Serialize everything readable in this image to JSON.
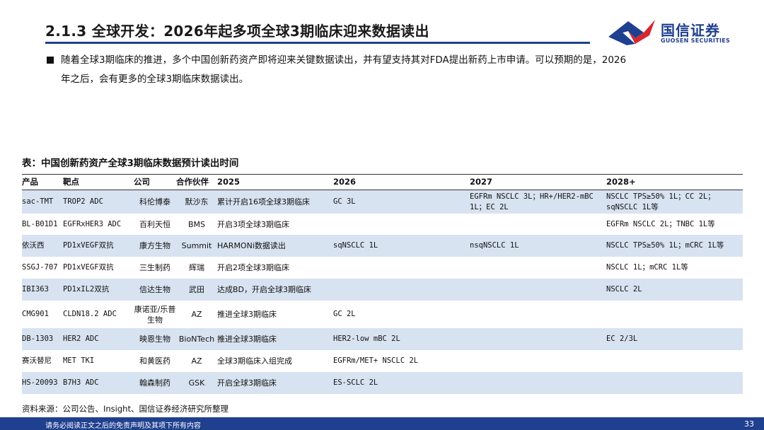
{
  "header": {
    "title": "2.1.3 全球开发：2026年起多项全球3期临床迎来数据读出",
    "logo_cn": "国信证券",
    "logo_en": "GUOSEN SECURITIES"
  },
  "bullet": {
    "line1": "随着全球3期临床的推进，多个中国创新药资产即将迎来关键数据读出，并有望支持其对FDA提出新药上市申请。可以预期的是，2026",
    "line2": "年之后，会有更多的全球3期临床数据读出。"
  },
  "table": {
    "title": "表：中国创新药资产全球3期临床数据预计读出时间",
    "headers": [
      "产品",
      "靶点",
      "公司",
      "合作伙伴",
      "2025",
      "2026",
      "2027",
      "2028+"
    ],
    "rows": [
      {
        "product": "sac-TMT",
        "target": "TROP2 ADC",
        "company": "科伦博泰",
        "partner": "默沙东",
        "y2025": "累计开启16项全球3期临床",
        "y2026": "GC 3L",
        "y2027": "EGFRm NSCLC 3L；HR+/HER2-mBC 1L；EC 2L",
        "y2028": "NSCLC TPS≥50% 1L；CC 2L；sqNSCLC 1L等"
      },
      {
        "product": "BL-B01D1",
        "target": "EGFRxHER3 ADC",
        "company": "百利天恒",
        "partner": "BMS",
        "y2025": "开启3项全球3期临床",
        "y2026": "",
        "y2027": "",
        "y2028": "EGFRm NSCLC 2L；TNBC 1L等"
      },
      {
        "product": "依沃西",
        "target": "PD1xVEGF双抗",
        "company": "康方生物",
        "partner": "Summit",
        "y2025": "HARMONi数据读出",
        "y2026": "sqNSCLC 1L",
        "y2027": "nsqNSCLC 1L",
        "y2028": "NSCLC TPS≥50% 1L；mCRC 1L等"
      },
      {
        "product": "SSGJ-707",
        "target": "PD1xVEGF双抗",
        "company": "三生制药",
        "partner": "辉瑞",
        "y2025": "开启2项全球3期临床",
        "y2026": "",
        "y2027": "",
        "y2028": "NSCLC 1L；mCRC 1L等"
      },
      {
        "product": "IBI363",
        "target": "PD1xIL2双抗",
        "company": "信达生物",
        "partner": "武田",
        "y2025": "达成BD，开启全球3期临床",
        "y2026": "",
        "y2027": "",
        "y2028": "NSCLC 2L"
      },
      {
        "product": "CMG901",
        "target": "CLDN18.2 ADC",
        "company": "康诺亚/乐普生物",
        "partner": "AZ",
        "y2025": "推进全球3期临床",
        "y2026": "GC 2L",
        "y2027": "",
        "y2028": ""
      },
      {
        "product": "DB-1303",
        "target": "HER2 ADC",
        "company": "映恩生物",
        "partner": "BioNTech",
        "y2025": "推进全球3期临床",
        "y2026": "HER2-low mBC 2L",
        "y2027": "",
        "y2028": "EC 2/3L"
      },
      {
        "product": "赛沃替尼",
        "target": "MET TKI",
        "company": "和黄医药",
        "partner": "AZ",
        "y2025": "全球3期临床入组完成",
        "y2026": "EGFRm/MET+ NSCLC 2L",
        "y2027": "",
        "y2028": ""
      },
      {
        "product": "HS-20093",
        "target": "B7H3 ADC",
        "company": "翰森制药",
        "partner": "GSK",
        "y2025": "开启全球3期临床",
        "y2026": "ES-SCLC 2L",
        "y2027": "",
        "y2028": ""
      }
    ]
  },
  "source": "资料来源：公司公告、Insight、国信证券经济研究所整理",
  "footer": {
    "disclaimer": "请务必阅读正文之后的免责声明及其项下所有内容",
    "page": "33"
  },
  "colors": {
    "brand_blue": "#1f3f8f",
    "brand_red": "#d7262f",
    "band": "#d8e3f1"
  }
}
